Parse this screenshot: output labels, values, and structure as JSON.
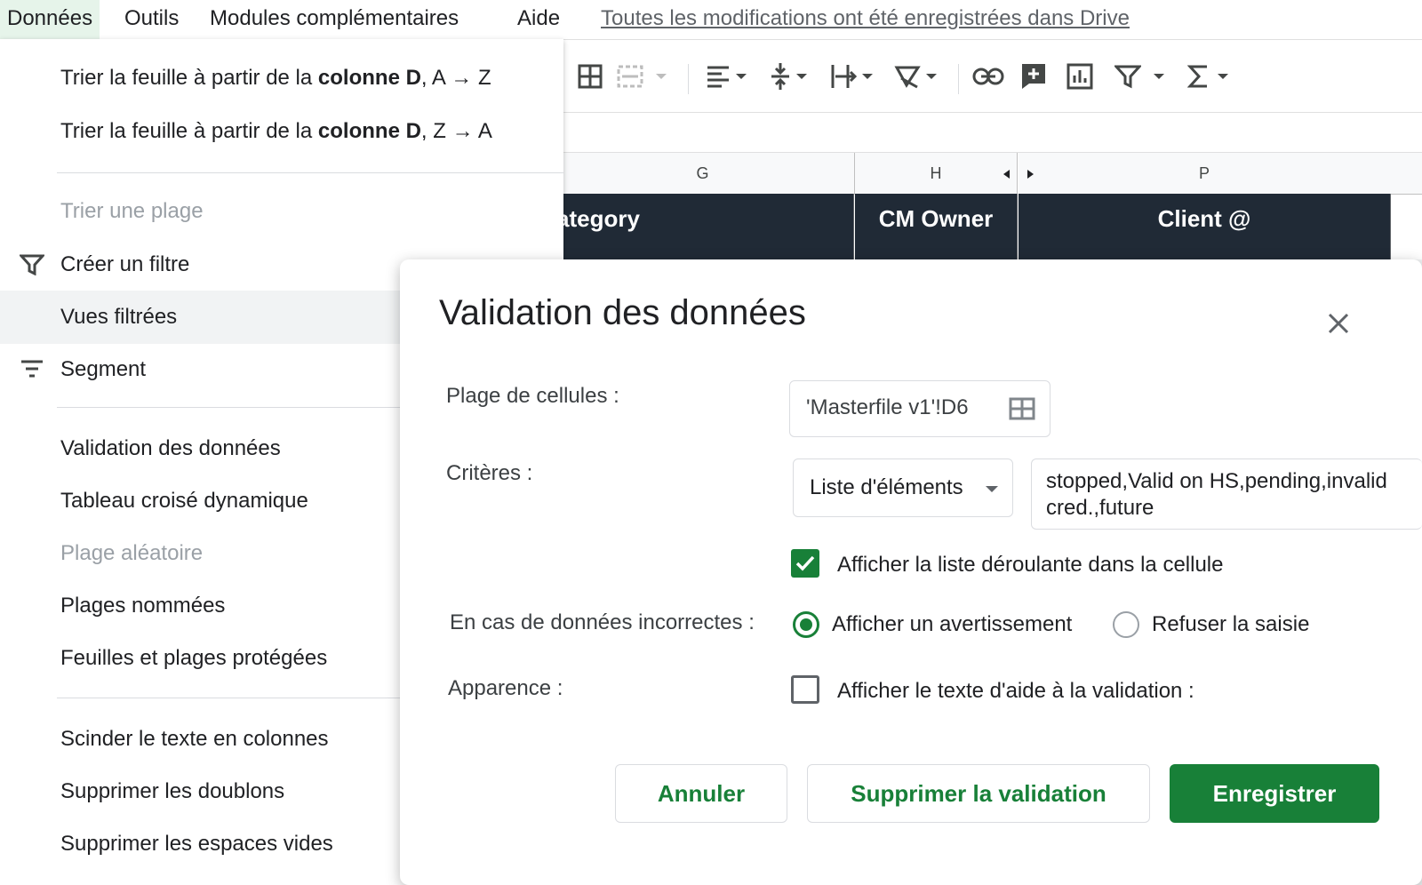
{
  "menubar": {
    "items": [
      "Données",
      "Outils",
      "Modules complémentaires",
      "Aide"
    ],
    "saved_status": "Toutes les modifications ont été enregistrées dans Drive"
  },
  "sheet": {
    "columns": [
      "G",
      "H",
      "P"
    ],
    "headers": [
      "ategory",
      "CM Owner",
      "Client @"
    ],
    "header_bg": "#202a36"
  },
  "menu": {
    "sort_az": {
      "prefix": "Trier la feuille à partir de la ",
      "bold": "colonne D",
      "suffix": ", A → Z"
    },
    "sort_za": {
      "prefix": "Trier la feuille à partir de la ",
      "bold": "colonne D",
      "suffix": ", Z → A"
    },
    "sort_range": "Trier une plage",
    "create_filter": "Créer un filtre",
    "filter_views": "Vues filtrées",
    "segment": "Segment",
    "data_validation": "Validation des données",
    "pivot_table": "Tableau croisé dynamique",
    "random_range": "Plage aléatoire",
    "named_ranges": "Plages nommées",
    "protected": "Feuilles et plages protégées",
    "split_text": "Scinder le texte en colonnes",
    "remove_duplicates": "Supprimer les doublons",
    "trim_whitespace": "Supprimer les espaces vides"
  },
  "dialog": {
    "title": "Validation des données",
    "range_label": "Plage de cellules :",
    "range_value": "'Masterfile v1'!D6",
    "criteria_label": "Critères :",
    "criteria_type": "Liste d'éléments",
    "criteria_value": "stopped,Valid on HS,pending,invalid cred.,future",
    "show_dropdown": "Afficher la liste déroulante dans la cellule",
    "show_dropdown_checked": true,
    "invalid_label": "En cas de données incorrectes :",
    "invalid_warn": "Afficher un avertissement",
    "invalid_reject": "Refuser la saisie",
    "invalid_selected": "warn",
    "appearance_label": "Apparence :",
    "help_text": "Afficher le texte d'aide à la validation :",
    "help_text_checked": false,
    "cancel": "Annuler",
    "remove": "Supprimer la validation",
    "save": "Enregistrer"
  },
  "colors": {
    "accent": "#188038",
    "menu_hover": "#f1f3f4",
    "menubar_active": "#e6f4ea"
  }
}
